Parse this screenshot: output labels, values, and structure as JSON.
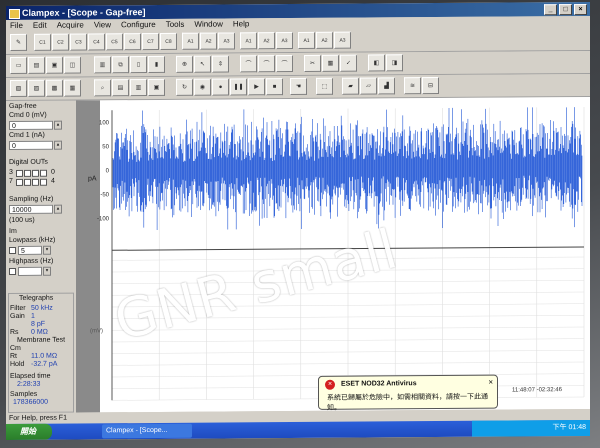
{
  "window": {
    "title": "Clampex - [Scope - Gap-free]"
  },
  "menu": [
    "File",
    "Edit",
    "Acquire",
    "View",
    "Configure",
    "Tools",
    "Window",
    "Help"
  ],
  "toolbar1": [
    "C1",
    "C2",
    "C3",
    "C4",
    "C5",
    "C6",
    "C7",
    "C8",
    "A1",
    "A2",
    "A3",
    "A1",
    "A2",
    "A3",
    "A1",
    "A2",
    "A3"
  ],
  "left_panel": {
    "mode": "Gap-free",
    "cmd0_label": "Cmd 0 (mV)",
    "cmd0_value": "0",
    "cmd1_label": "Cmd 1 (nA)",
    "cmd1_value": "0",
    "digital_outs_label": "Digital OUTs",
    "digital_left": [
      "3",
      "7"
    ],
    "digital_right": [
      "0",
      "4"
    ],
    "sampling_label": "Sampling (Hz)",
    "sampling_value": "10000",
    "sampling_note": "(100 us)",
    "lm_label": "Im",
    "lowpass_label": "Lowpass (kHz)",
    "lowpass_value": "5",
    "highpass_label": "Highpass (Hz)",
    "telegraphs_label": "Telegraphs",
    "filter_label": "Filter",
    "filter_value": "50 kHz",
    "gain_label": "Gain",
    "gain_value": "1",
    "cm_value": "8 pF",
    "rs_label": "Rs",
    "rs_value": "0 MΩ",
    "membrane_test_label": "Membrane Test",
    "cm_label": "Cm",
    "rt_label": "Rt",
    "rt_value": "11.0 MΩ",
    "hold_label": "Hold",
    "hold_value": "-32.7 pA",
    "elapsed_label": "Elapsed time",
    "elapsed_value": "2:28:33",
    "samples_label": "Samples",
    "samples_value": "178366000"
  },
  "scope": {
    "ticks_y": [
      "100",
      "50",
      "0",
      "-50",
      "-100"
    ],
    "y_unit": "pA",
    "lower_unit": "(mV)",
    "time_readout": "11:48:07 -02:32:46",
    "trace_color": "#1f55d6"
  },
  "statusbar": {
    "text": "For Help, press F1"
  },
  "taskbar": {
    "start": "開始",
    "item": "Clampex - [Scope..."
  },
  "tray": {
    "time": "下午 01:48"
  },
  "balloon": {
    "title": "ESET NOD32 Antivirus",
    "message": "系統已歸屬於危險中，如需相關資料，請按一下此通知。"
  },
  "watermark": "GNR small"
}
